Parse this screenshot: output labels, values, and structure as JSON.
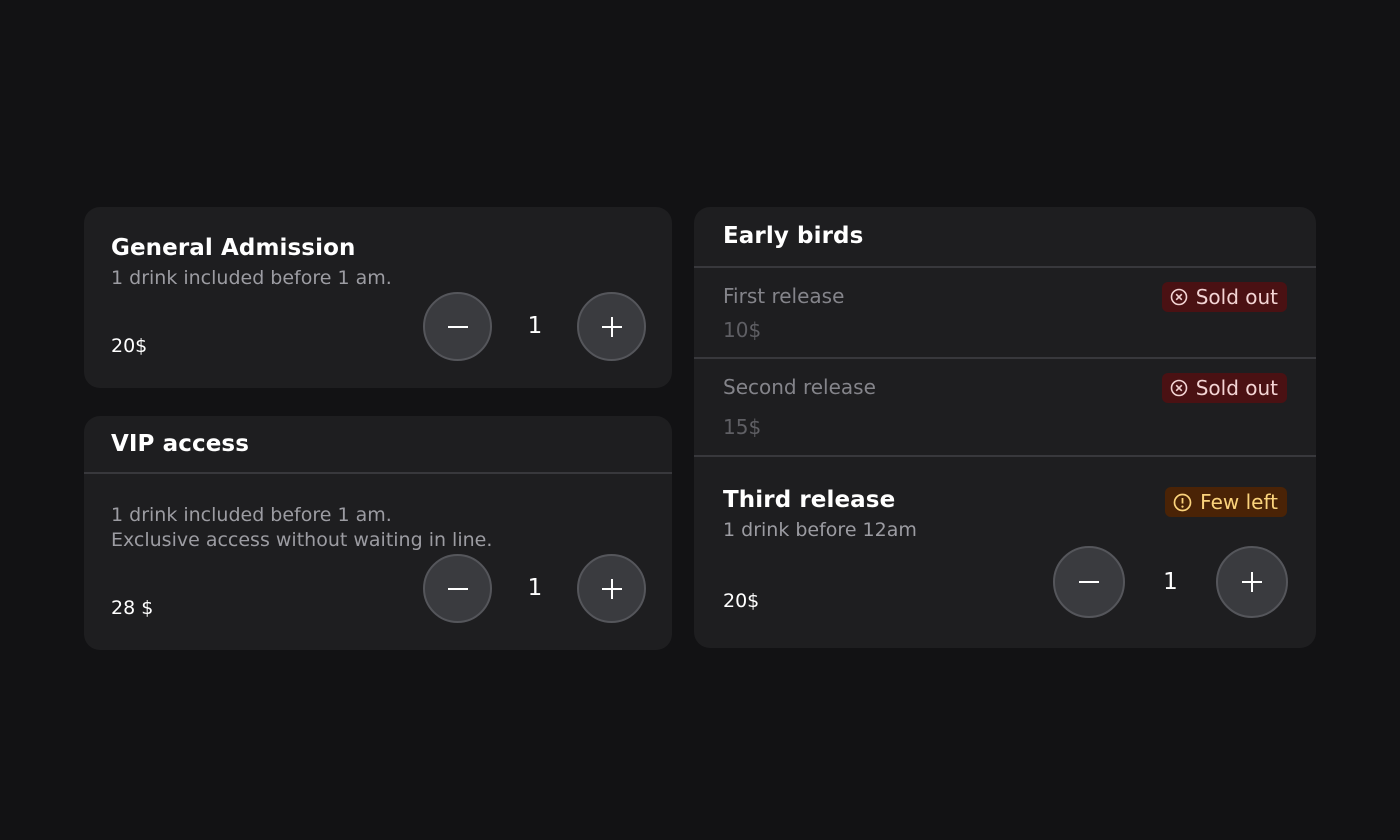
{
  "general": {
    "title": "General Admission",
    "description": "1 drink included before 1 am.",
    "price": "20$",
    "quantity": "1"
  },
  "vip": {
    "title": "VIP access",
    "description_line1": "1 drink included before 1 am.",
    "description_line2": "Exclusive access without waiting in line.",
    "price": "28 $",
    "quantity": "1"
  },
  "early_birds": {
    "title": "Early birds",
    "releases": [
      {
        "name": "First release",
        "price": "10$",
        "status": "Sold out"
      },
      {
        "name": "Second release",
        "price": "15$",
        "status": "Sold out"
      },
      {
        "name": "Third release",
        "description": "1 drink before 12am",
        "price": "20$",
        "status": "Few left",
        "quantity": "1"
      }
    ]
  },
  "icons": {
    "minus": "minus-icon",
    "plus": "plus-icon",
    "sold_out": "x-circle-icon",
    "few_left": "alert-circle-icon"
  },
  "colors": {
    "background": "#121214",
    "card": "#1e1e20",
    "sold_out_bg": "#4a1113",
    "few_left_bg": "#4a2306",
    "few_left_text": "#fbd37c"
  }
}
